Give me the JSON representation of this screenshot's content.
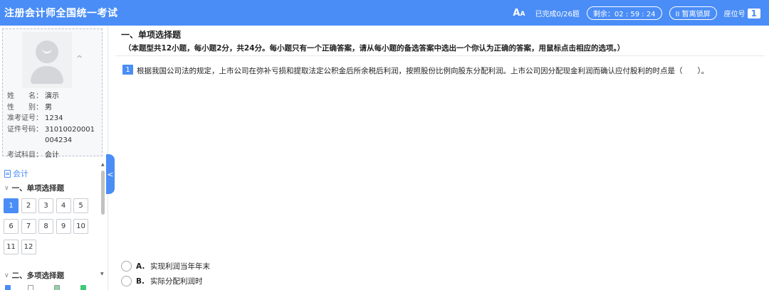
{
  "header": {
    "title": "注册会计师全国统一考试",
    "completed": "已完成0/26题",
    "timer": "剩余：02 : 59 : 24",
    "pause_label": "II 暂离锁屏",
    "seat_label": "座位号",
    "seat_number": "1"
  },
  "profile": {
    "rows": [
      {
        "label": "姓　　名：",
        "value": "演示"
      },
      {
        "label": "性　　别：",
        "value": "男"
      },
      {
        "label": "准考证号：",
        "value": "1234"
      },
      {
        "label": "证件号码：",
        "value": "31010020001004234"
      },
      {
        "label": "考试科目：",
        "value": "会计"
      }
    ]
  },
  "sidebar": {
    "subject": "会计",
    "section1": "一、单项选择题",
    "section2": "二、多项选择题",
    "questions": [
      "1",
      "2",
      "3",
      "4",
      "5",
      "6",
      "7",
      "8",
      "9",
      "10",
      "11",
      "12"
    ],
    "active_question": "1"
  },
  "main": {
    "section_title": "一、单项选择题",
    "section_desc": "（本题型共12小题，每小题2分，共24分。每小题只有一个正确答案，请从每小题的备选答案中选出一个你认为正确的答案，用鼠标点击相应的选项。）",
    "question_number": "1",
    "question_text": "根据我国公司法的规定，上市公司在弥补亏损和提取法定公积金后所余税后利润，按照股份比例向股东分配利润。上市公司因分配现金利润而确认应付股利的时点是（　　）。",
    "options": [
      {
        "letter": "A.",
        "text": "实现利润当年年末"
      },
      {
        "letter": "B.",
        "text": "实际分配利润时"
      }
    ]
  },
  "colors": {
    "accent": "#4a8df6",
    "legend": [
      "#4a8df6",
      "#ffffff",
      "#8fd3a8",
      "#3ec97a"
    ]
  }
}
